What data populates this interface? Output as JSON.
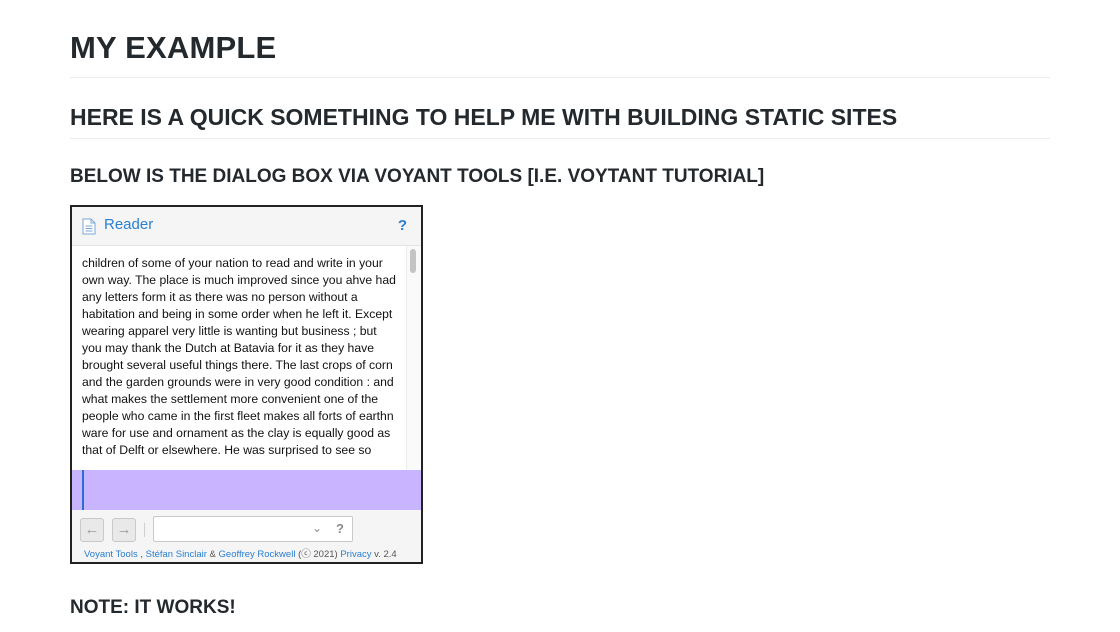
{
  "page": {
    "title": "MY EXAMPLE",
    "subtitle": "HERE IS A QUICK SOMETHING TO HELP ME WITH BUILDING STATIC SITES",
    "section_heading": "BELOW IS THE DIALOG BOX VIA VOYANT TOOLS [I.E. VOYTANT TUTORIAL]",
    "note": "NOTE: IT WORKS!"
  },
  "widget": {
    "title": "Reader",
    "help_label": "?",
    "body_text": "children of some of your nation to read and write in your own way. The place is much improved since you ahve had any letters form it as there was no person without a habitation and being in some order when he left it. Except wearing apparel very little is wanting but business ; but you may thank the Dutch at Batavia for it as they have brought several useful things there. The last crops of corn and the garden grounds were in very good condition : and what makes the settlement more convenient one of the people who came in the first fleet makes all forts of earthn ware for use and ornament as the clay is equally good as that of Delft or elsewhere. He was surprised to see so",
    "toolbar": {
      "back_icon": "←",
      "forward_icon": "→",
      "select_value": "",
      "select_chevron": "⌄",
      "select_help": "?"
    },
    "footer": {
      "voyant_tools": "Voyant Tools",
      "comma": " , ",
      "author1": "Stéfan Sinclair",
      "and": " & ",
      "author2": "Geoffrey Rockwell",
      "open_paren": " (",
      "copyright": "ⓒ 2021",
      "close_paren": ") ",
      "privacy": "Privacy",
      "version": " v. 2.4"
    }
  },
  "colors": {
    "link": "#2a7fd0",
    "highlight": "#c8b4ff",
    "heading": "#24292e"
  }
}
